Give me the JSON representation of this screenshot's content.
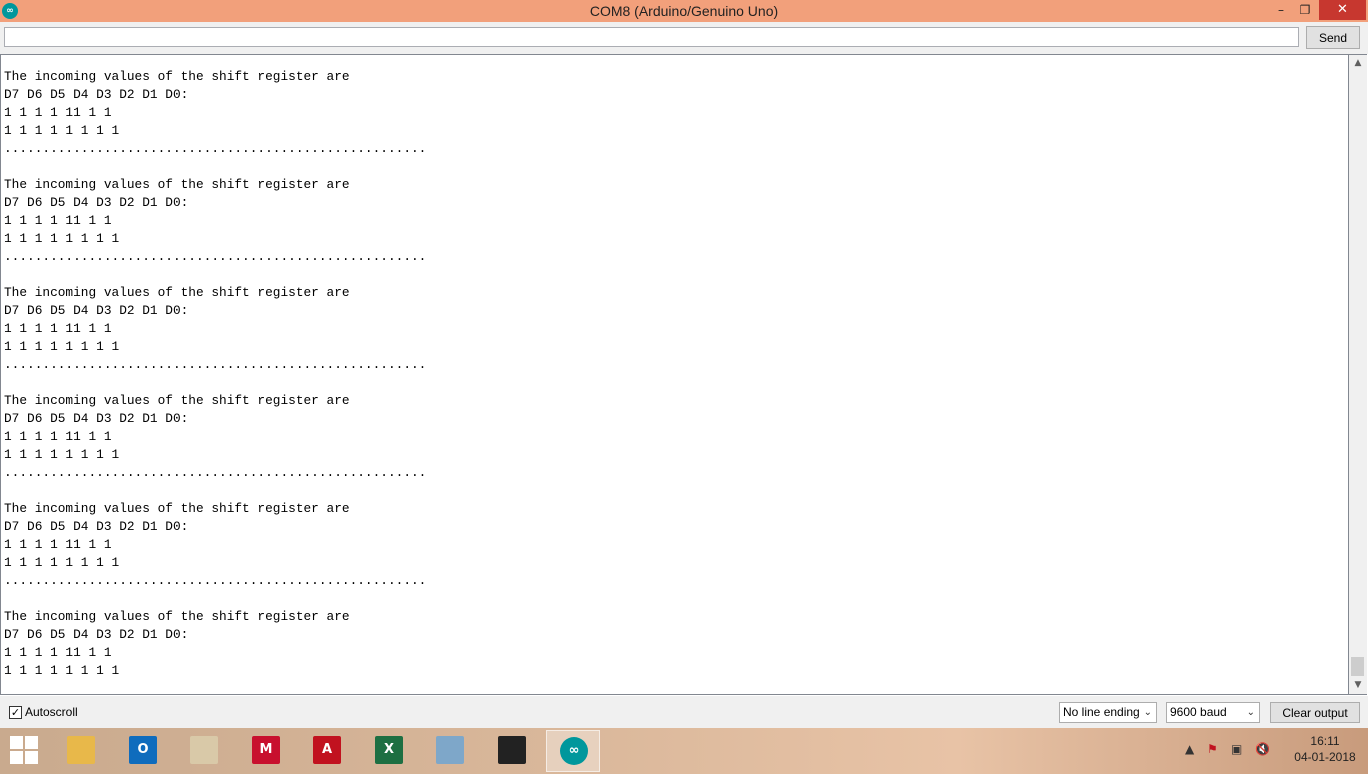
{
  "window": {
    "title": "COM8 (Arduino/Genuino Uno)",
    "app_icon_glyph": "∞",
    "minimize_glyph": "–",
    "maximize_glyph": "❐",
    "close_glyph": "✕"
  },
  "send_row": {
    "input_value": "",
    "send_label": "Send"
  },
  "output": {
    "lines": [
      "The incoming values of the shift register are",
      "D7 D6 D5 D4 D3 D2 D1 D0:",
      "1 1 1 1 11 1 1",
      "1 1 1 1 1 1 1 1",
      ".......................................................",
      "",
      "The incoming values of the shift register are",
      "D7 D6 D5 D4 D3 D2 D1 D0:",
      "1 1 1 1 11 1 1",
      "1 1 1 1 1 1 1 1",
      ".......................................................",
      "",
      "The incoming values of the shift register are",
      "D7 D6 D5 D4 D3 D2 D1 D0:",
      "1 1 1 1 11 1 1",
      "1 1 1 1 1 1 1 1",
      ".......................................................",
      "",
      "The incoming values of the shift register are",
      "D7 D6 D5 D4 D3 D2 D1 D0:",
      "1 1 1 1 11 1 1",
      "1 1 1 1 1 1 1 1",
      ".......................................................",
      "",
      "The incoming values of the shift register are",
      "D7 D6 D5 D4 D3 D2 D1 D0:",
      "1 1 1 1 11 1 1",
      "1 1 1 1 1 1 1 1",
      ".......................................................",
      "",
      "The incoming values of the shift register are",
      "D7 D6 D5 D4 D3 D2 D1 D0:",
      "1 1 1 1 11 1 1",
      "1 1 1 1 1 1 1 1"
    ]
  },
  "scrollbar": {
    "up_glyph": "▲",
    "down_glyph": "▼",
    "position": 1.0
  },
  "bottom_bar": {
    "autoscroll_checked": true,
    "autoscroll_check_glyph": "✓",
    "autoscroll_label": "Autoscroll",
    "line_ending": "No line ending",
    "baud": "9600 baud",
    "clear_label": "Clear output",
    "chevron_glyph": "⌄"
  },
  "taskbar": {
    "apps": [
      {
        "name": "file-explorer",
        "icon": "folder-icon",
        "color": "#e8b84a",
        "glyph": ""
      },
      {
        "name": "outlook",
        "icon": "outlook-icon",
        "color": "#0f6cbd",
        "glyph": "O"
      },
      {
        "name": "paint",
        "icon": "palette-icon",
        "color": "#d9c9a8",
        "glyph": ""
      },
      {
        "name": "mplab-ide",
        "icon": "mplab-icon",
        "color": "#c8102e",
        "glyph": "M"
      },
      {
        "name": "acrobat",
        "icon": "pdf-icon",
        "color": "#c1121f",
        "glyph": "A"
      },
      {
        "name": "excel",
        "icon": "excel-icon",
        "color": "#1d6f42",
        "glyph": "X"
      },
      {
        "name": "calculator",
        "icon": "calculator-icon",
        "color": "#7ea7c9",
        "glyph": ""
      },
      {
        "name": "proteus",
        "icon": "chip-icon",
        "color": "#222222",
        "glyph": ""
      },
      {
        "name": "arduino",
        "icon": "arduino-icon",
        "color": "#00979c",
        "glyph": "∞"
      }
    ],
    "tray_glyphs": {
      "chevron": "▲",
      "flag": "⚑",
      "network": "▣",
      "volume": "🔇"
    },
    "clock_time": "16:11",
    "clock_date": "04-01-2018"
  }
}
